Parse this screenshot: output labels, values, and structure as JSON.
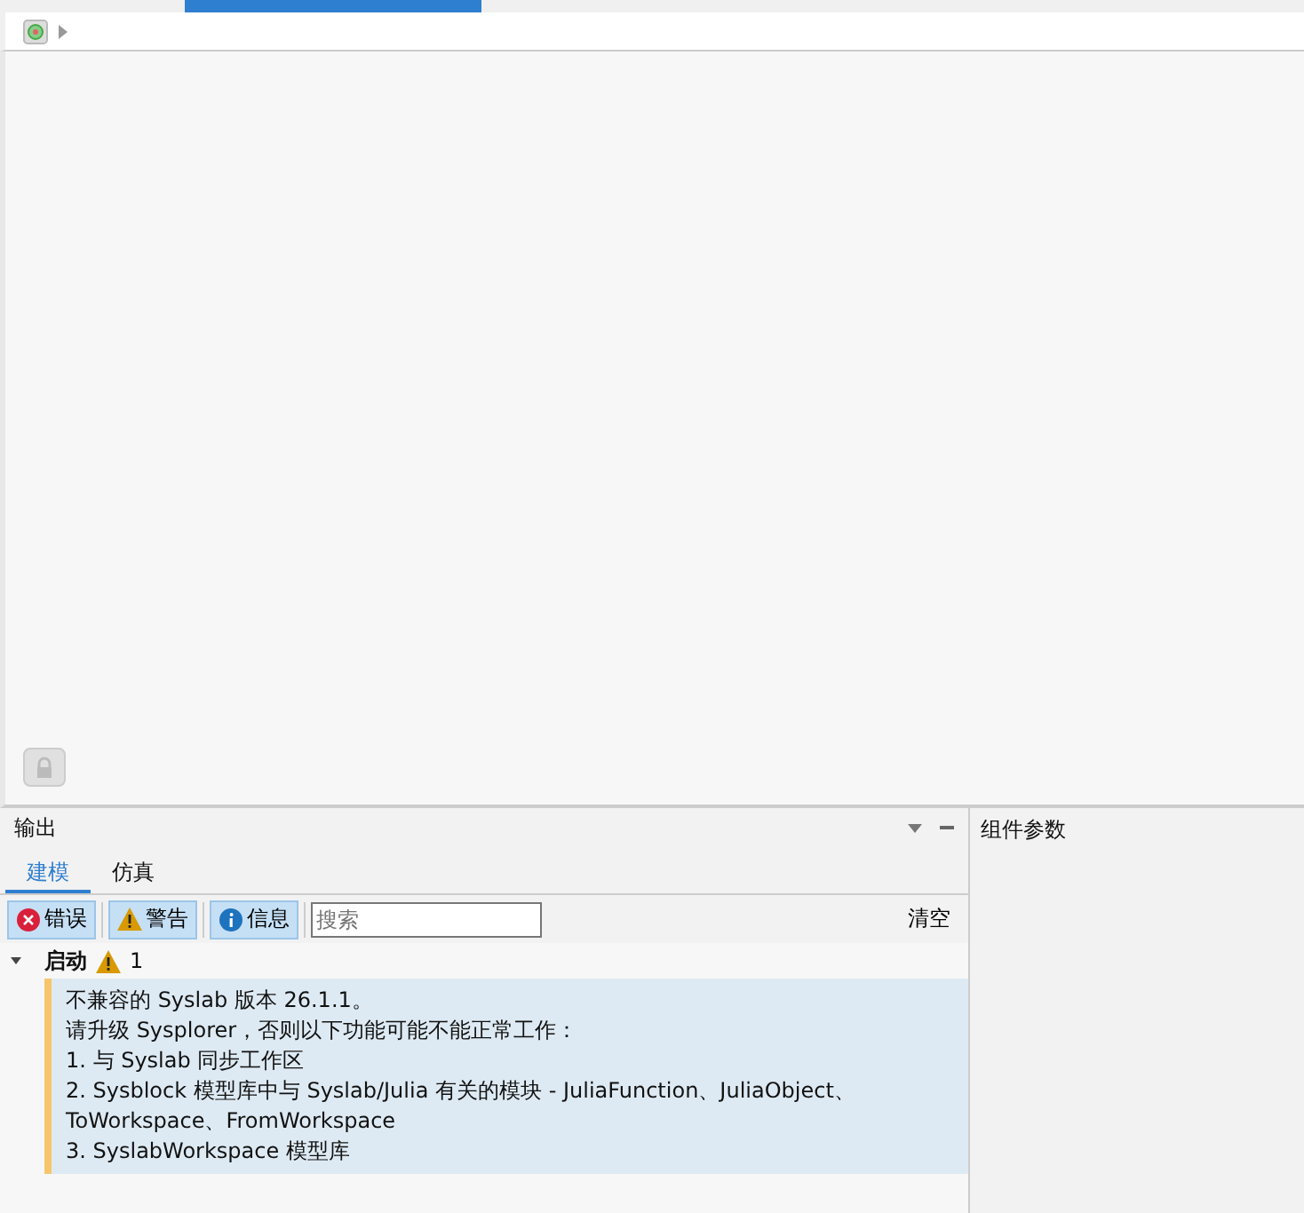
{
  "output": {
    "title": "输出",
    "tabs": [
      {
        "label": "建模",
        "selected": true
      },
      {
        "label": "仿真",
        "selected": false
      }
    ],
    "filters": [
      {
        "kind": "error",
        "label": "错误",
        "selected": true
      },
      {
        "kind": "warning",
        "label": "警告",
        "selected": true
      },
      {
        "kind": "info",
        "label": "信息",
        "selected": true
      }
    ],
    "search": {
      "placeholder": "搜索"
    },
    "clear_button": "清空",
    "log_groups": [
      {
        "title": "启动",
        "expanded": true,
        "warning_count": "1",
        "messages": [
          {
            "lines": [
              "不兼容的 Syslab 版本 26.1.1。",
              "请升级 Sysplorer，否则以下功能可能不能正常工作：",
              "1. 与 Syslab 同步工作区",
              "2. Sysblock 模型库中与 Syslab/Julia 有关的模块 - JuliaFunction、JuliaObject、ToWorkspace、FromWorkspace",
              "3. SyslabWorkspace 模型库"
            ]
          }
        ]
      }
    ]
  },
  "properties_panel": {
    "title": "组件参数"
  }
}
